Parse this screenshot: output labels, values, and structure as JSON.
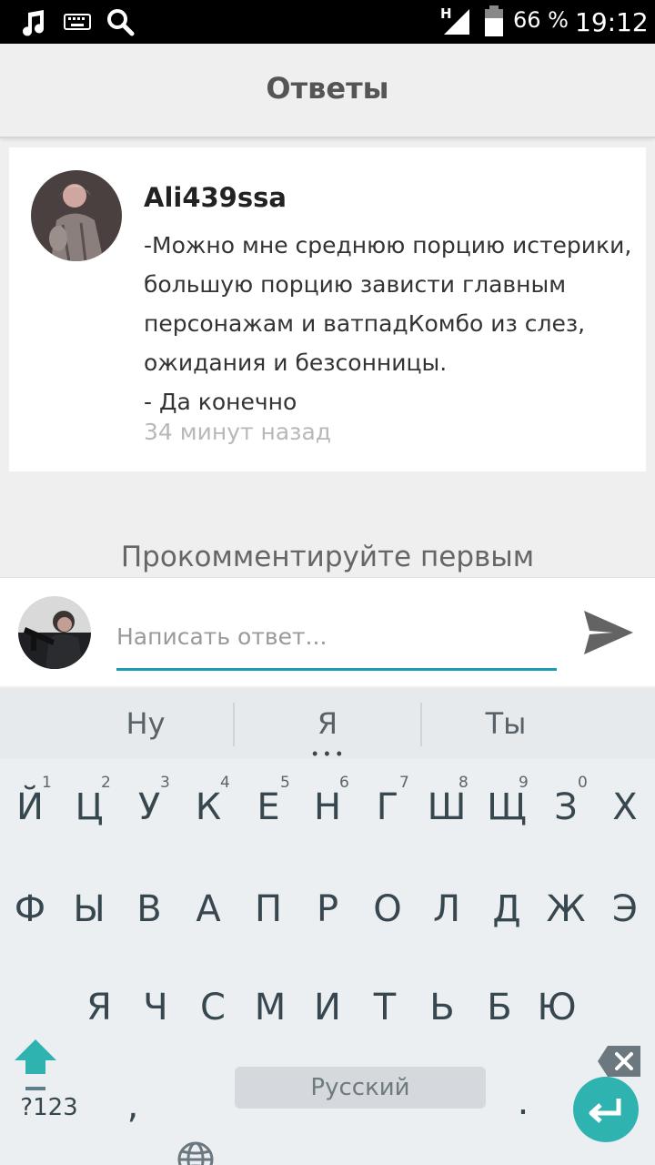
{
  "status_bar": {
    "battery": "66 %",
    "time": "19:12",
    "network_label": "H",
    "icons": [
      "music-icon",
      "keyboard-icon",
      "search-icon",
      "signal-icon",
      "battery-icon"
    ]
  },
  "header": {
    "title": "Ответы"
  },
  "comment": {
    "username": "Ali439ssa",
    "text": "-Можно мне среднюю порцию истерики, большую порцию зависти главным персонажам и ватпадКомбо из слез, ожидания и безсонницы.",
    "reply_line": "- Да конечно",
    "time": "34 минут назад"
  },
  "empty_state": {
    "text": "Прокомментируйте первым"
  },
  "reply": {
    "placeholder": "Написать ответ..."
  },
  "keyboard": {
    "suggestions": [
      "Ну",
      "Я",
      "Ты"
    ],
    "row1": [
      "Й",
      "Ц",
      "У",
      "К",
      "Е",
      "Н",
      "Г",
      "Ш",
      "Щ",
      "З",
      "Х"
    ],
    "row1_hints": [
      "1",
      "2",
      "3",
      "4",
      "5",
      "6",
      "7",
      "8",
      "9",
      "0"
    ],
    "row2": [
      "Ф",
      "Ы",
      "В",
      "А",
      "П",
      "Р",
      "О",
      "Л",
      "Д",
      "Ж",
      "Э"
    ],
    "row3": [
      "Я",
      "Ч",
      "С",
      "М",
      "И",
      "Т",
      "Ь",
      "Б",
      "Ю"
    ],
    "symbols_label": "?123",
    "comma": ",",
    "period": ".",
    "space_label": "Русский"
  },
  "colors": {
    "accent": "#1c9cb0",
    "enter": "#2fb3b1",
    "shift": "#2fb3b1"
  }
}
